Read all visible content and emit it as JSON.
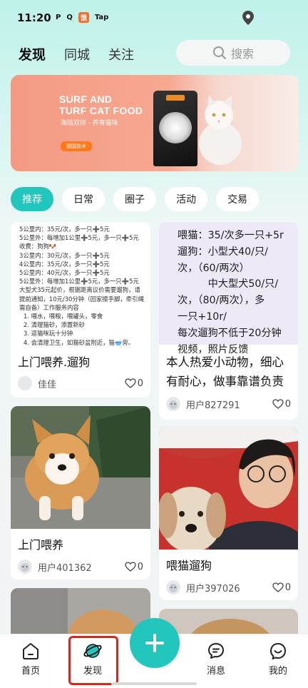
{
  "status_bar": {
    "time": "11:20",
    "icons": [
      "P",
      "Q",
      "饿",
      "Tap"
    ]
  },
  "header": {
    "tabs": [
      {
        "label": "发现",
        "active": true
      },
      {
        "label": "同城"
      },
      {
        "label": "关注"
      }
    ],
    "search_placeholder": "搜索"
  },
  "banner": {
    "title_line1": "SURF AND",
    "title_line2": "TURF CAT FOOD",
    "subtitle": "海陆双拼 · 养育猫咪",
    "badge": "德国技术"
  },
  "chips": [
    {
      "label": "推荐",
      "active": true
    },
    {
      "label": "日常"
    },
    {
      "label": "圈子"
    },
    {
      "label": "活动"
    },
    {
      "label": "交易"
    }
  ],
  "posts": [
    {
      "price_lines": [
        "5公里内：35元/次，多一只➕5元",
        "5公里外：每增加1公里➕5元，多一只➕5元",
        "收费：狗狗🐶",
        "3公里内：30元/次，多一只➕5元",
        "4公里内：35元/次，多一只➕5元",
        "5公里内：40元/次，多一只➕5元",
        "5公里外：每增加1公里➕5元，多一只➕5元",
        "大型犬35元起价，根据距离议价需要遛狗，请",
        "提前通知，10元/30分钟（回家擦手脚，牵引绳",
        "需自备）工作服务内容",
        "1. 喂水，喂粮，喂罐头，零食",
        "2. 清理猫砂，添置新砂",
        "3. 逗猫咪玩十分钟",
        "4. 会清理卫生，如猫砂盆附近，猫🥣旁。"
      ],
      "title": "上门喂养.遛狗",
      "user": "佳佳",
      "likes": "0"
    },
    {
      "text_lines": [
        "喂猫：35/次多一只+5r",
        "遛狗：小型犬40/只/",
        "次，（60/两次）",
        "　　　中大型犬50/只/",
        "次，（80/两次），多",
        "一只+10r/",
        "每次遛狗不低于20分钟",
        "视频，照片反馈"
      ],
      "title": "本人热爱小动物，细心有耐心，做事靠谱负责",
      "user": "用户827291",
      "likes": "0"
    },
    {
      "title": "上门喂养",
      "user": "用户401362",
      "likes": "0"
    },
    {
      "title": "喂猫遛狗",
      "user": "用户397026",
      "likes": "0"
    }
  ],
  "bottom_nav": [
    {
      "label": "首页",
      "icon": "home-icon"
    },
    {
      "label": "发现",
      "icon": "planet-icon",
      "active": true
    },
    {
      "label": "消息",
      "icon": "chat-icon"
    },
    {
      "label": "我的",
      "icon": "smile-icon"
    }
  ],
  "colors": {
    "accent": "#23c6bd",
    "highlight": "#d9261c"
  }
}
